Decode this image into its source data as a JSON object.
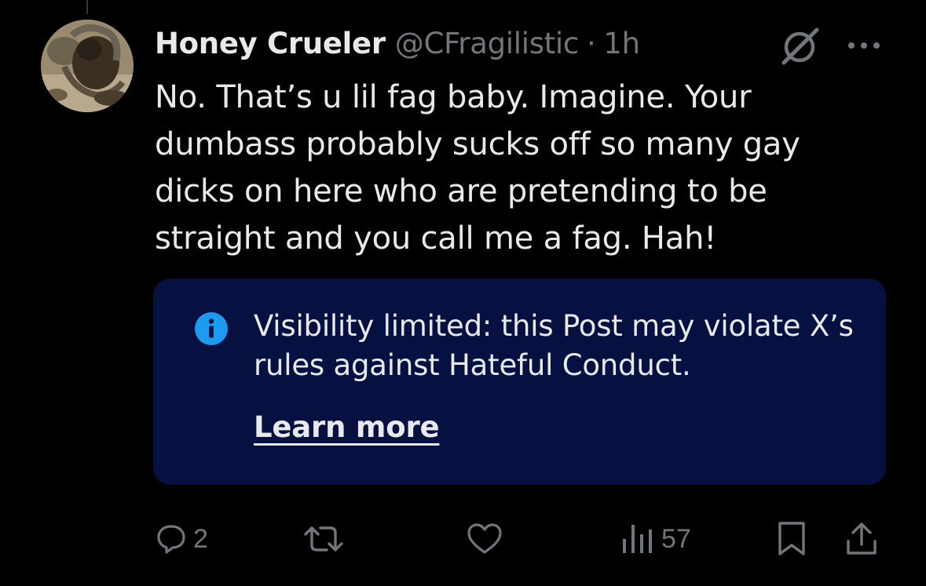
{
  "post": {
    "display_name": "Honey Crueler",
    "handle": "@CFragilistic",
    "separator": "·",
    "time": "1h",
    "text": "No. That’s u lil fag baby. Imagine. Your\ndumbass probably sucks off so many gay\ndicks on here who are pretending to be\nstraight and you call me a fag. Hah!"
  },
  "notice": {
    "icon": "info-icon",
    "text": "Visibility limited: this Post may violate X’s rules against Hateful Conduct.",
    "link_label": "Learn more"
  },
  "actions": {
    "reply_count": "2",
    "repost_count": "",
    "like_count": "",
    "views_count": "57"
  },
  "icons": {
    "header": [
      "grok-icon",
      "more-icon"
    ],
    "actions": [
      "reply-icon",
      "repost-icon",
      "like-icon",
      "views-icon",
      "bookmark-icon",
      "share-icon"
    ]
  },
  "colors": {
    "background": "#000000",
    "text_primary": "#e7e9ea",
    "text_secondary": "#71767b",
    "notice_background": "#061142",
    "info_icon": "#1d9bf0"
  }
}
